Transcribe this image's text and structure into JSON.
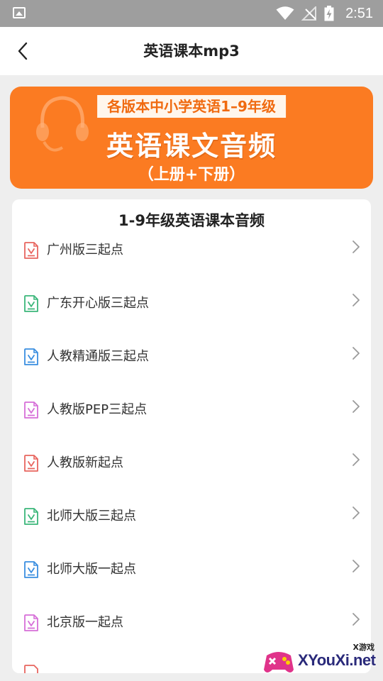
{
  "status_bar": {
    "time": "2:51",
    "icons": [
      "image-icon",
      "wifi-icon",
      "no-signal-icon",
      "battery-charging-icon"
    ]
  },
  "header": {
    "title": "英语课本mp3",
    "back_icon": "chevron-left-icon"
  },
  "banner": {
    "tag": "各版本中小学英语1–9年级",
    "headline": "英语课文音频",
    "subline": "（上册+下册）",
    "background": "#fb7b22"
  },
  "list": {
    "title": "1-9年级英语课本音频",
    "items": [
      {
        "label": "广州版三起点",
        "icon_color": "#e8655f"
      },
      {
        "label": "广东开心版三起点",
        "icon_color": "#3bb67a"
      },
      {
        "label": "人教精通版三起点",
        "icon_color": "#3a8ee0"
      },
      {
        "label": "人教版PEP三起点",
        "icon_color": "#d66fd8"
      },
      {
        "label": "人教版新起点",
        "icon_color": "#e8655f"
      },
      {
        "label": "北师大版三起点",
        "icon_color": "#3bb67a"
      },
      {
        "label": "北师大版一起点",
        "icon_color": "#3a8ee0"
      },
      {
        "label": "北京版一起点",
        "icon_color": "#d66fd8"
      }
    ]
  },
  "watermark": {
    "small": "X游戏",
    "text": "XYouXi.net"
  }
}
